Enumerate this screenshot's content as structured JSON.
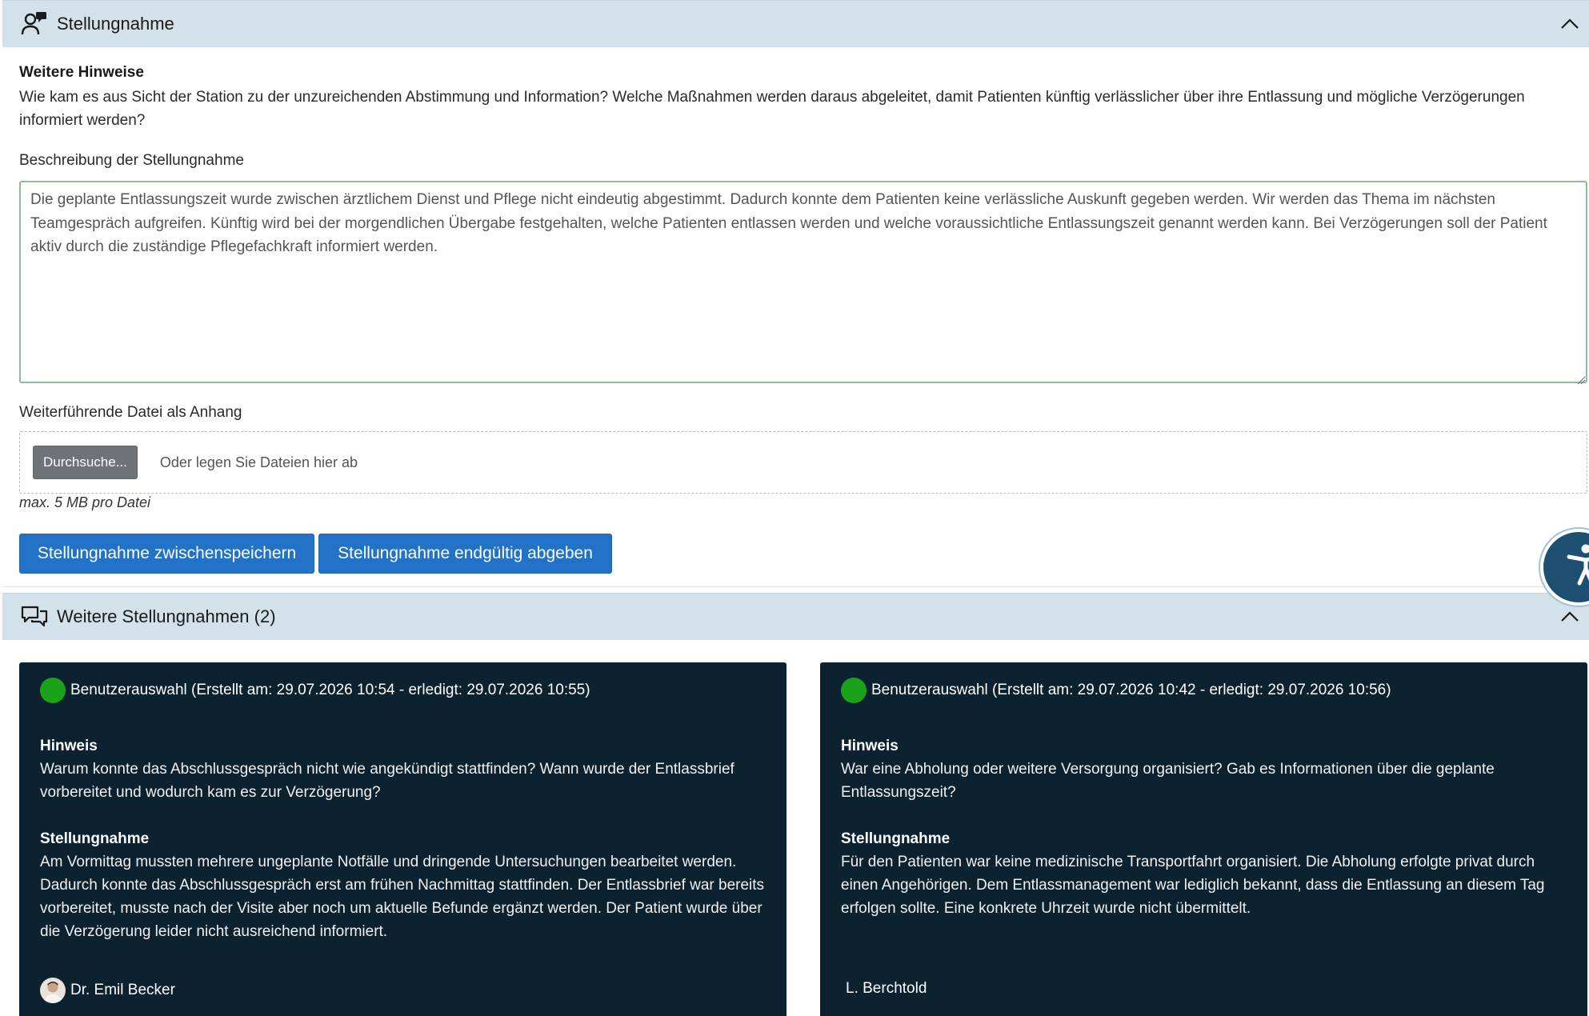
{
  "section1": {
    "title": "Stellungnahme",
    "hinweise_label": "Weitere Hinweise",
    "hinweise_text": "Wie kam es aus Sicht der Station zu der unzureichenden Abstimmung und Information? Welche Maßnahmen werden daraus abgeleitet, damit Patienten künftig verlässlicher über ihre Entlassung und mögliche Verzögerungen informiert werden?",
    "desc_label": "Beschreibung der Stellungnahme",
    "desc_value": "Die geplante Entlassungszeit wurde zwischen ärztlichem Dienst und Pflege nicht eindeutig abgestimmt. Dadurch konnte dem Patienten keine verlässliche Auskunft gegeben werden. Wir werden das Thema im nächsten Teamgespräch aufgreifen. Künftig wird bei der morgendlichen Übergabe festgehalten, welche Patienten entlassen werden und welche voraussichtliche Entlassungszeit genannt werden kann. Bei Verzögerungen soll der Patient aktiv durch die zuständige Pflegefachkraft informiert werden.",
    "attach_label": "Weiterführende Datei als Anhang",
    "browse_label": "Durchsuche...",
    "drop_text": "Oder legen Sie Dateien hier ab",
    "max_size": "max. 5 MB pro Datei",
    "save_button": "Stellungnahme zwischenspeichern",
    "submit_button": "Stellungnahme endgültig abgeben"
  },
  "section2": {
    "title": "Weitere Stellungnahmen (2)",
    "cards": [
      {
        "header": "Benutzerauswahl (Erstellt am: 29.07.2026 10:54 - erledigt: 29.07.2026 10:55)",
        "hint_label": "Hinweis",
        "hint_text": "Warum konnte das Abschlussgespräch nicht wie angekündigt stattfinden? Wann wurde der Entlassbrief vorbereitet und wodurch kam es zur Verzögerung?",
        "statement_label": "Stellungnahme",
        "statement_text": "Am Vormittag mussten mehrere ungeplante Notfälle und dringende Untersuchungen bearbeitet werden. Dadurch konnte das Abschlussgespräch erst am frühen Nachmittag stattfinden. Der Entlassbrief war bereits vorbereitet, musste nach der Visite aber noch um aktuelle Befunde ergänzt werden. Der Patient wurde über die Verzögerung leider nicht ausreichend informiert.",
        "author": "Dr. Emil Becker"
      },
      {
        "header": "Benutzerauswahl (Erstellt am: 29.07.2026 10:42 - erledigt: 29.07.2026 10:56)",
        "hint_label": "Hinweis",
        "hint_text": "War eine Abholung oder weitere Versorgung organisiert? Gab es Informationen über die geplante Entlassungszeit?",
        "statement_label": "Stellungnahme",
        "statement_text": "Für den Patienten war keine medizinische Transportfahrt organisiert. Die Abholung erfolgte privat durch einen Angehörigen. Dem Entlassmanagement war lediglich bekannt, dass die Entlassung an diesem Tag erfolgen sollte. Eine konkrete Uhrzeit wurde nicht übermittelt.",
        "author": "L. Berchtold"
      }
    ]
  },
  "colors": {
    "header_bg": "#d3e1ea",
    "primary": "#2273c7",
    "card_bg": "#0c2230",
    "status_done": "#1aa31a",
    "accessibility": "#1d4f73"
  },
  "icons": {
    "section1": "person-comment-icon",
    "section2": "chat-bubbles-icon",
    "collapse": "chevron-up-icon",
    "accessibility": "accessibility-icon"
  }
}
